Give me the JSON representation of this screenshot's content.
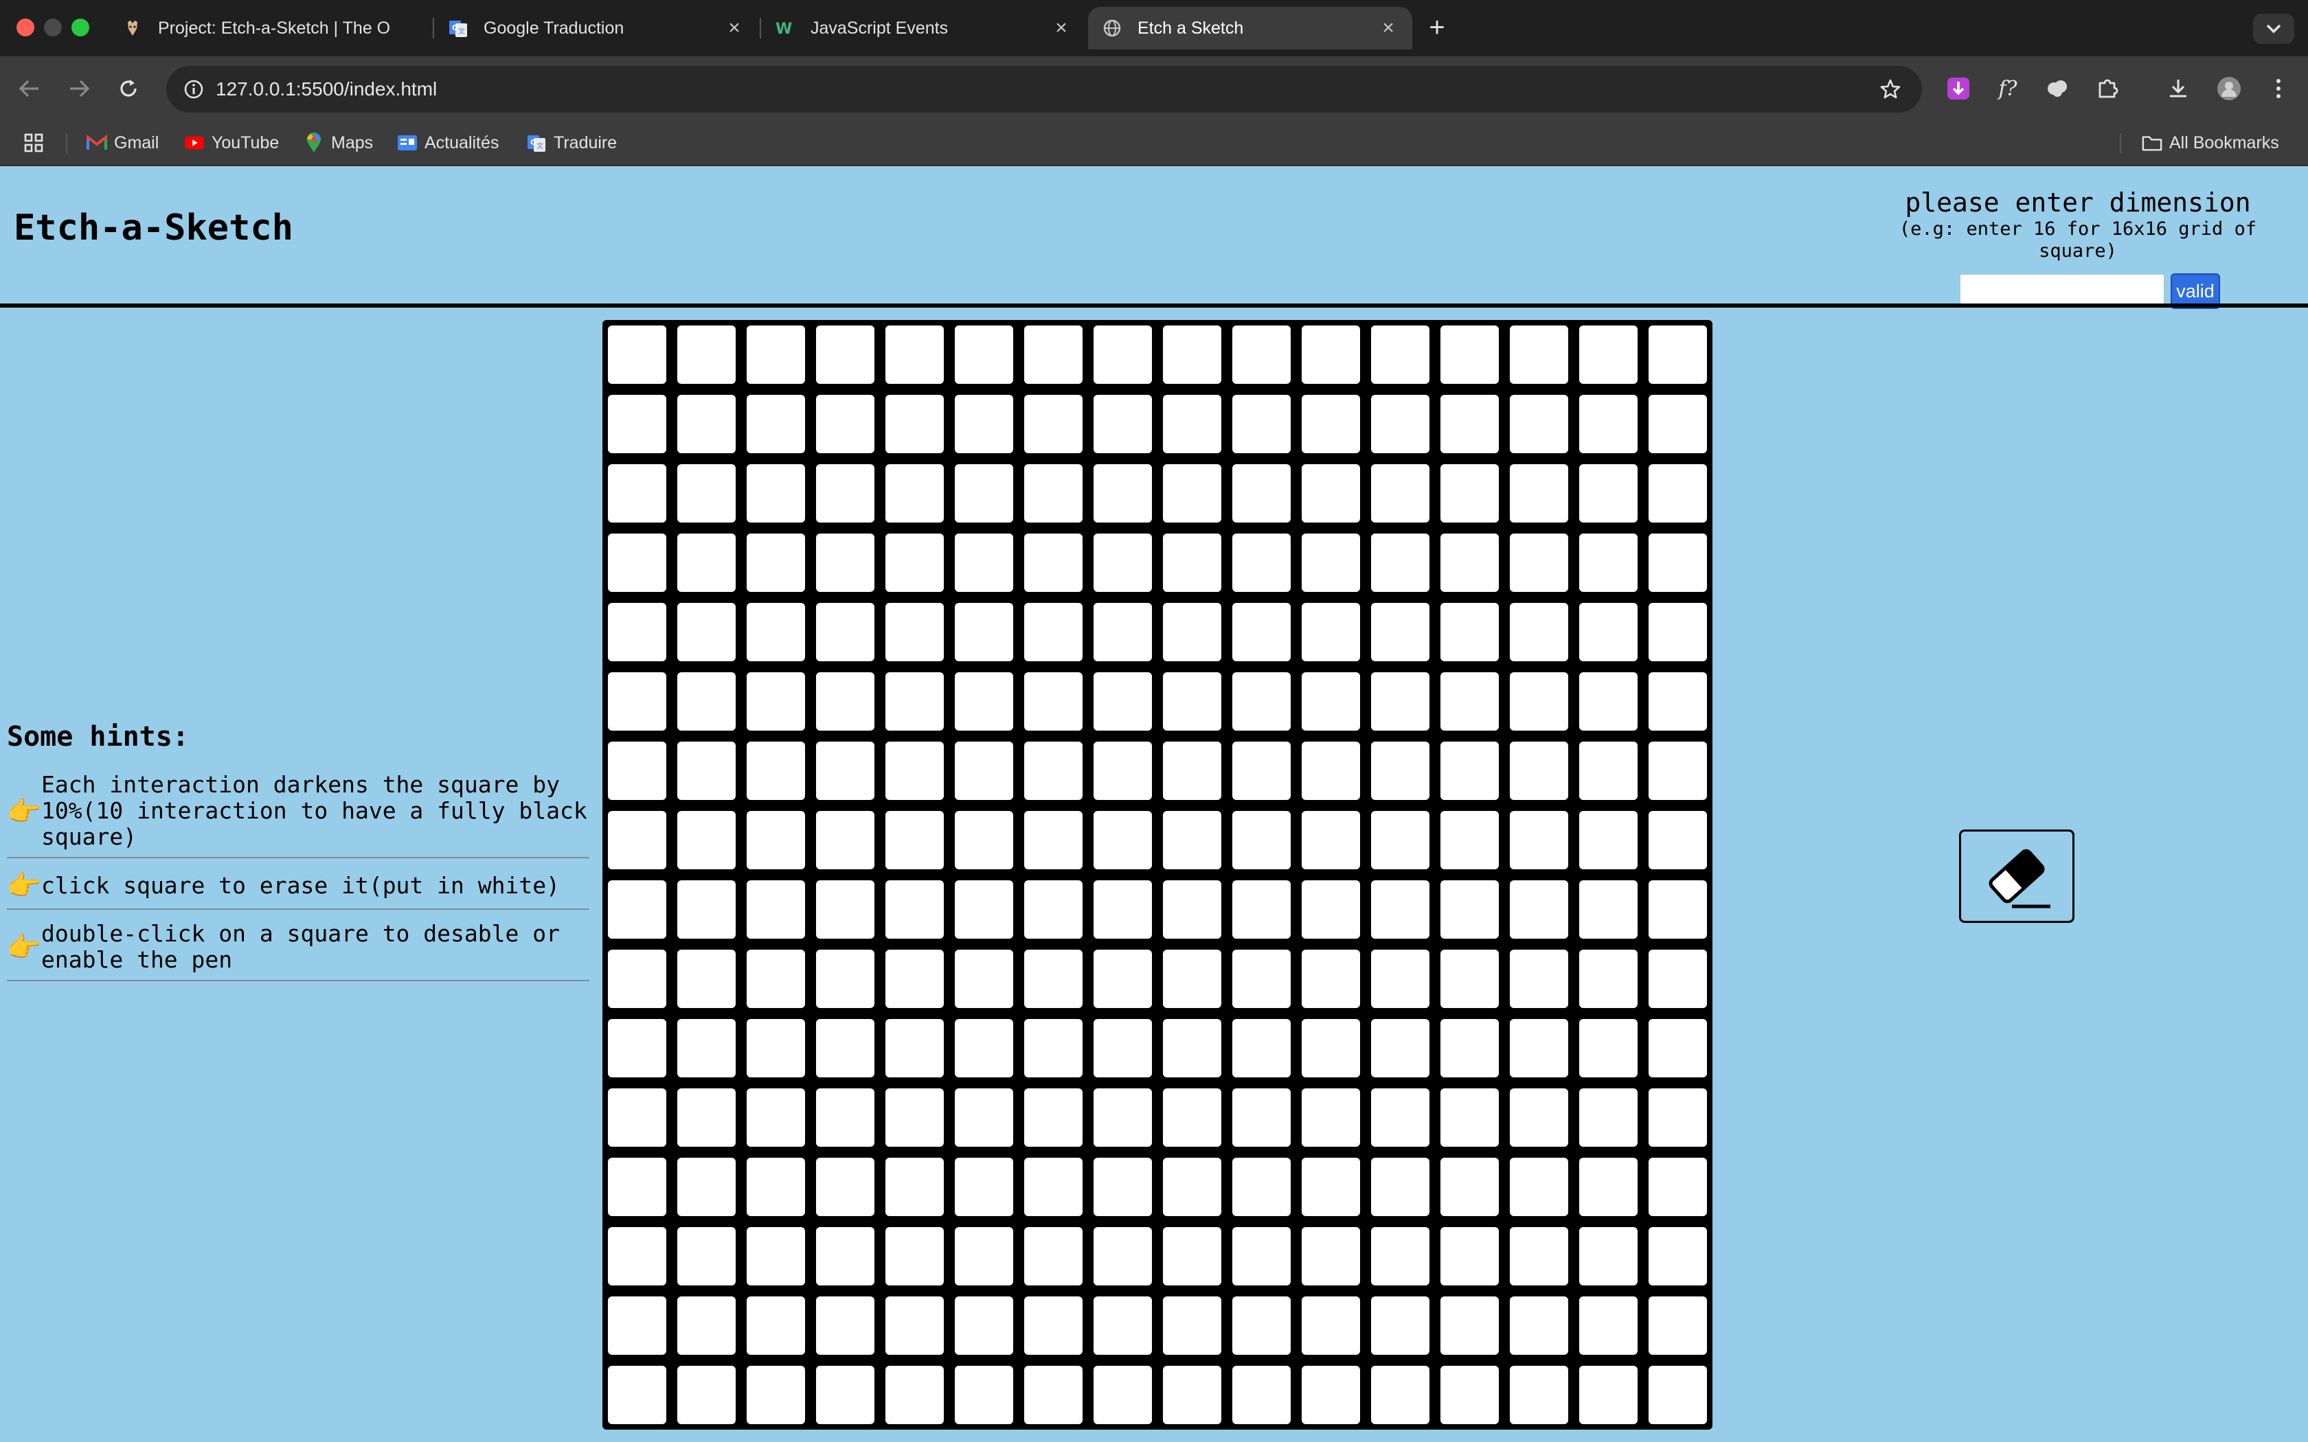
{
  "browser": {
    "tabs": [
      {
        "title": "Project: Etch-a-Sketch | The O",
        "icon": "odin-icon",
        "active": false
      },
      {
        "title": "Google Traduction",
        "icon": "google-translate-icon",
        "active": false
      },
      {
        "title": "JavaScript Events",
        "icon": "w3schools-icon",
        "active": false
      },
      {
        "title": "Etch a Sketch",
        "icon": "globe-icon",
        "active": true
      }
    ],
    "url": "127.0.0.1:5500/index.html",
    "bookmarks": [
      {
        "label": "Gmail",
        "icon": "gmail-icon"
      },
      {
        "label": "YouTube",
        "icon": "youtube-icon"
      },
      {
        "label": "Maps",
        "icon": "maps-icon"
      },
      {
        "label": "Actualités",
        "icon": "google-news-icon"
      },
      {
        "label": "Traduire",
        "icon": "google-translate-icon"
      }
    ],
    "all_bookmarks_label": "All Bookmarks"
  },
  "page": {
    "title": "Etch-a-Sketch",
    "dimension": {
      "title": "please enter dimension",
      "example": "(e.g: enter 16 for 16x16 grid of square)",
      "input_value": "",
      "button_label": "valid"
    },
    "hints": {
      "title": "Some hints:",
      "items": [
        "Each interaction darkens the square by 10%(10 interaction to have a fully black square)",
        "click square to erase it(put in white)",
        "double-click on a square to desable or enable the pen"
      ]
    },
    "grid": {
      "rows": 16,
      "cols": 16
    },
    "eraser_icon": "eraser-icon",
    "colors": {
      "background": "#98cde9",
      "grid": "#000000",
      "cell": "#ffffff",
      "button": "#2f6de3"
    }
  }
}
